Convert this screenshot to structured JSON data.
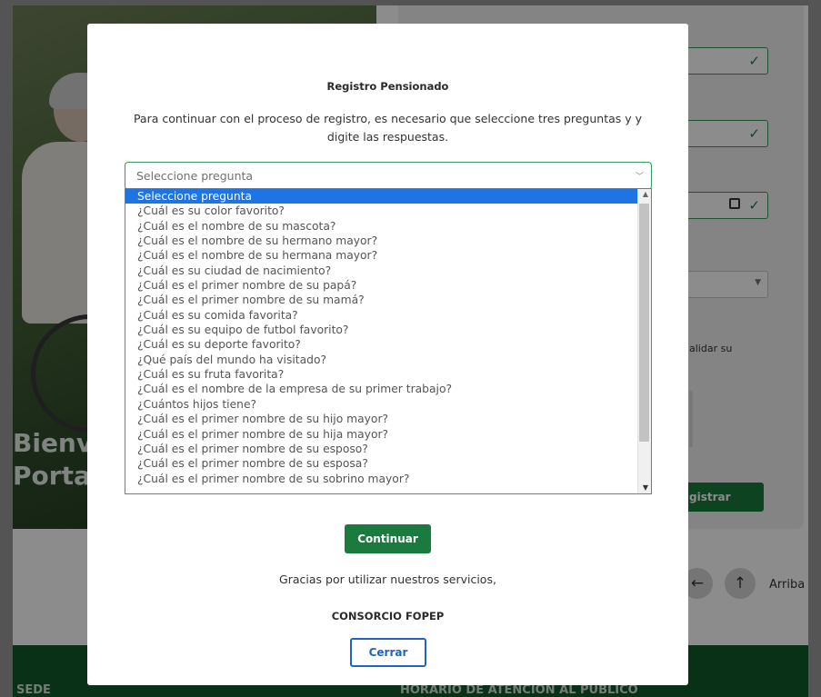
{
  "background": {
    "hero_title_line1": "Bienve",
    "hero_title_line2": "Portal",
    "validate_text": "alidar su",
    "register_button": "gistrar",
    "arriba_label": "Arriba",
    "footer_sede": "SEDE",
    "footer_horario": "HORARIO DE ATENCIÓN AL PÚBLICO",
    "brand_green": "#1b7a3e"
  },
  "modal": {
    "title": "Registro Pensionado",
    "description": "Para continuar con el proceso de registro, es necesario que seleccione tres preguntas y y digite las respuestas.",
    "select": {
      "value": "Seleccione pregunta",
      "options": [
        "Seleccione pregunta",
        "¿Cuál es su color favorito?",
        "¿Cuál es el nombre de su mascota?",
        "¿Cuál es el nombre de su hermano mayor?",
        "¿Cuál es el nombre de su hermana mayor?",
        "¿Cuál es su ciudad de nacimiento?",
        "¿Cuál es el primer nombre de su papá?",
        "¿Cuál es el primer nombre de su mamá?",
        "¿Cuál es su comida favorita?",
        "¿Cuál es su equipo de futbol favorito?",
        "¿Cuál es su deporte favorito?",
        "¿Qué país del mundo ha visitado?",
        "¿Cuál es su fruta favorita?",
        "¿Cuál es el nombre de la empresa de su primer trabajo?",
        "¿Cuántos hijos tiene?",
        "¿Cuál es el primer nombre de su hijo mayor?",
        "¿Cuál es el primer nombre de su hija mayor?",
        "¿Cuál es el primer nombre de su esposo?",
        "¿Cuál es el primer nombre de su esposa?",
        "¿Cuál es el primer nombre de su sobrino mayor?"
      ]
    },
    "continue_label": "Continuar",
    "thanks": "Gracias por utilizar nuestros servicios,",
    "company": "CONSORCIO FOPEP",
    "close_label": "Cerrar"
  }
}
